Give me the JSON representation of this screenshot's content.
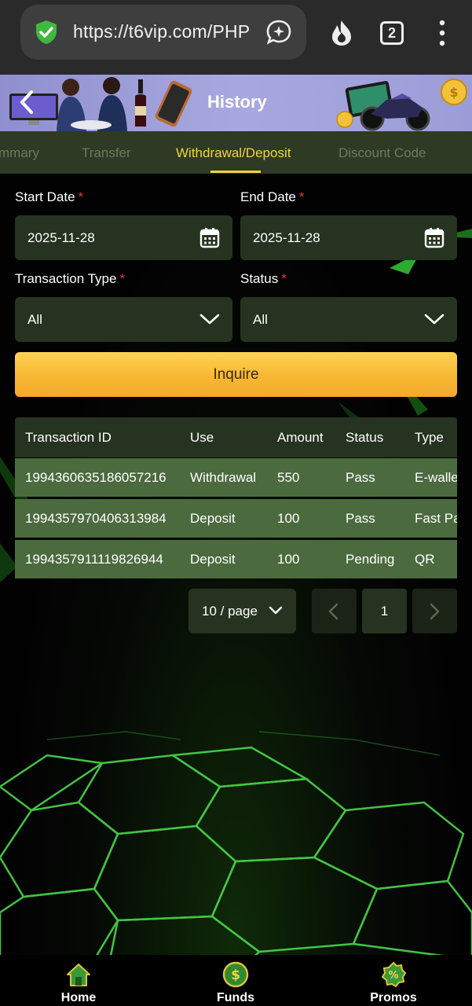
{
  "browser": {
    "url": "https://t6vip.com/PHP",
    "tab_count": "2"
  },
  "header": {
    "title": "History"
  },
  "nav": {
    "tabs": [
      {
        "label": "mmary"
      },
      {
        "label": "Transfer"
      },
      {
        "label": "Withdrawal/Deposit"
      },
      {
        "label": "Discount Code"
      }
    ],
    "active_index": 2
  },
  "filters": {
    "start_date": {
      "label": "Start Date",
      "required": "*",
      "value": "2025-11-28"
    },
    "end_date": {
      "label": "End Date",
      "required": "*",
      "value": "2025-11-28"
    },
    "transaction_type": {
      "label": "Transaction Type",
      "required": "*",
      "value": "All"
    },
    "status": {
      "label": "Status",
      "required": "*",
      "value": "All"
    },
    "inquire_label": "Inquire"
  },
  "table": {
    "headers": [
      "Transaction ID",
      "Use",
      "Amount",
      "Status",
      "Type"
    ],
    "rows": [
      [
        "1994360635186057216",
        "Withdrawal",
        "550",
        "Pass",
        "E-walle"
      ],
      [
        "1994357970406313984",
        "Deposit",
        "100",
        "Pass",
        "Fast Pa"
      ],
      [
        "1994357911119826944",
        "Deposit",
        "100",
        "Pending",
        "QR"
      ]
    ]
  },
  "pagination": {
    "page_size": "10 / page",
    "current_page": "1"
  },
  "bottom_nav": {
    "items": [
      {
        "label": "Home",
        "icon": "home-icon"
      },
      {
        "label": "Funds",
        "icon": "funds-icon"
      },
      {
        "label": "Promos",
        "icon": "promos-icon"
      }
    ]
  },
  "colors": {
    "accent": "#f2d244",
    "inquire": "#f7b733",
    "row_bg": "#4b6a3e",
    "field_bg": "#263320",
    "required": "#e23b3b"
  }
}
